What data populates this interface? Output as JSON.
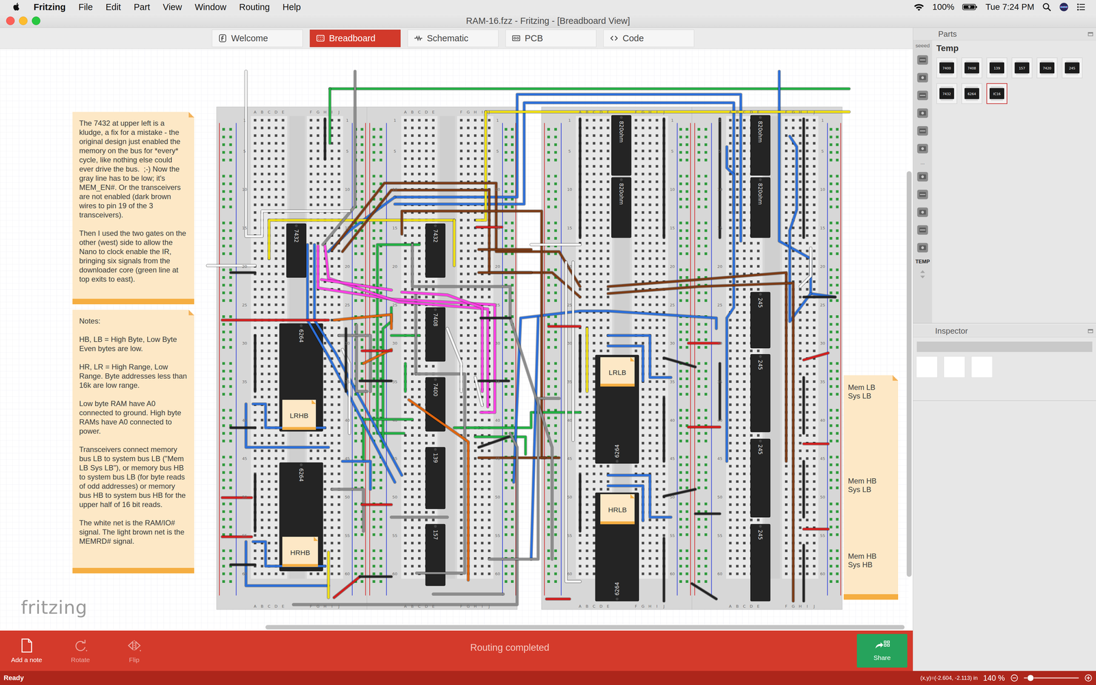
{
  "menubar": {
    "app": "Fritzing",
    "menus": [
      "File",
      "Edit",
      "Part",
      "View",
      "Window",
      "Routing",
      "Help"
    ],
    "battery": "100%",
    "clock": "Tue 7:24 PM"
  },
  "window": {
    "title": "RAM-16.fzz - Fritzing - [Breadboard View]"
  },
  "tabs": [
    {
      "label": "Welcome",
      "selected": false
    },
    {
      "label": "Breadboard",
      "selected": true
    },
    {
      "label": "Schematic",
      "selected": false
    },
    {
      "label": "PCB",
      "selected": false
    },
    {
      "label": "Code",
      "selected": false
    }
  ],
  "canvas": {
    "notes": [
      {
        "paragraphs": [
          "The 7432 at upper left is a kludge, a fix for a mistake - the original design just enabled the memory on the bus for *every* cycle, like nothing else could ever drive the bus.  ;-) Now the gray line has to be low; it's MEM_EN#. Or the transceivers are not enabled (dark brown wires to pin 19 of the 3 transceivers).",
          "Then I used the two gates on the other (west) side to allow the Nano to clock enable the IR, bringing six signals from the downloader core (green line at top exits to east)."
        ]
      },
      {
        "paragraphs": [
          "Notes:",
          "HB, LB = High Byte, Low Byte Even bytes are low.",
          "HR, LR = High Range, Low Range. Byte addresses less than 16k are low range.",
          "Low byte RAM have A0 connected to ground. High byte RAMs have A0 connected to power.",
          "Transceivers connect memory bus LB to system bus LB (\"Mem LB Sys LB\"), or memory bus HB to system bus LB (for byte reads of odd addresses) or memory bus HB to system bus HB for the upper half of 16 bit reads.",
          "The white net is the RAM/IO# signal. The light brown net is the MEMRD# signal."
        ]
      }
    ],
    "side_note": {
      "labels": [
        {
          "lines": [
            "Mem LB",
            "Sys LB"
          ]
        },
        {
          "lines": [
            "Mem HB",
            "Sys LB"
          ]
        },
        {
          "lines": [
            "Mem HB",
            "Sys HB"
          ]
        }
      ]
    },
    "chips": [
      {
        "label": "7432"
      },
      {
        "label": "7432"
      },
      {
        "label": "7408"
      },
      {
        "label": "7400"
      },
      {
        "label": "139"
      },
      {
        "label": "157"
      },
      {
        "label": "6264"
      },
      {
        "label": "6264"
      },
      {
        "label": "820ohm"
      },
      {
        "label": "820ohm"
      },
      {
        "label": "820ohm"
      },
      {
        "label": "820ohm"
      },
      {
        "label": "6264"
      },
      {
        "label": "6264"
      },
      {
        "label": "245"
      },
      {
        "label": "245"
      },
      {
        "label": "245"
      },
      {
        "label": "245"
      }
    ],
    "chip_notes": [
      {
        "label": "LRHB"
      },
      {
        "label": "HRHB"
      },
      {
        "label": "LRLB"
      },
      {
        "label": "HRLB"
      }
    ],
    "breadboard": {
      "columns": [
        "A",
        "B",
        "C",
        "D",
        "E",
        "F",
        "G",
        "H",
        "I",
        "J"
      ],
      "row_marks": [
        "1",
        "5",
        "10",
        "15",
        "20",
        "25",
        "30",
        "35",
        "40",
        "45",
        "50",
        "55",
        "60"
      ]
    },
    "wires": [
      {
        "color": "#22b043"
      },
      {
        "color": "#2c6fd9"
      },
      {
        "color": "#f0e014"
      },
      {
        "color": "#7b3b16"
      },
      {
        "color": "#8c8c8c"
      },
      {
        "color": "#f5f5f5"
      },
      {
        "color": "#ff40e4"
      },
      {
        "color": "#e0650e"
      },
      {
        "color": "#d21e1e"
      },
      {
        "color": "#232323"
      }
    ],
    "logo": "fritzing"
  },
  "parts_panel": {
    "title": "Parts",
    "bin_title": "Temp",
    "bins": [
      {
        "kind": "text",
        "label": "seeed",
        "selected": false
      },
      {
        "kind": "icon",
        "selected": false
      },
      {
        "kind": "icon",
        "selected": false
      },
      {
        "kind": "icon",
        "selected": false
      },
      {
        "kind": "icon",
        "selected": false
      },
      {
        "kind": "icon",
        "selected": false
      },
      {
        "kind": "icon",
        "selected": false
      },
      {
        "kind": "text",
        "label": "...",
        "selected": false
      },
      {
        "kind": "icon",
        "selected": false
      },
      {
        "kind": "icon",
        "selected": false
      },
      {
        "kind": "icon",
        "selected": false
      },
      {
        "kind": "icon",
        "selected": false
      },
      {
        "kind": "icon",
        "selected": false
      },
      {
        "kind": "text",
        "label": "TEMP",
        "selected": true
      }
    ],
    "parts": [
      {
        "label": "7400",
        "selected": false
      },
      {
        "label": "7408",
        "selected": false
      },
      {
        "label": "139",
        "selected": false
      },
      {
        "label": "157",
        "selected": false
      },
      {
        "label": "7420",
        "selected": false
      },
      {
        "label": "245",
        "selected": false
      },
      {
        "label": "7432",
        "selected": false
      },
      {
        "label": "6264",
        "selected": false
      },
      {
        "label": "IC16",
        "selected": true
      }
    ]
  },
  "inspector": {
    "title": "Inspector"
  },
  "toolbar": {
    "buttons": [
      {
        "label": "Add a note",
        "disabled": false
      },
      {
        "label": "Rotate",
        "disabled": true
      },
      {
        "label": "Flip",
        "disabled": true
      }
    ],
    "message": "Routing completed",
    "share": "Share"
  },
  "status_bar": {
    "text": "Ready",
    "coordinates": "(x,y)=(-2.604, -2.113) in",
    "zoom": "140 %",
    "zoom_level": 0.12
  }
}
